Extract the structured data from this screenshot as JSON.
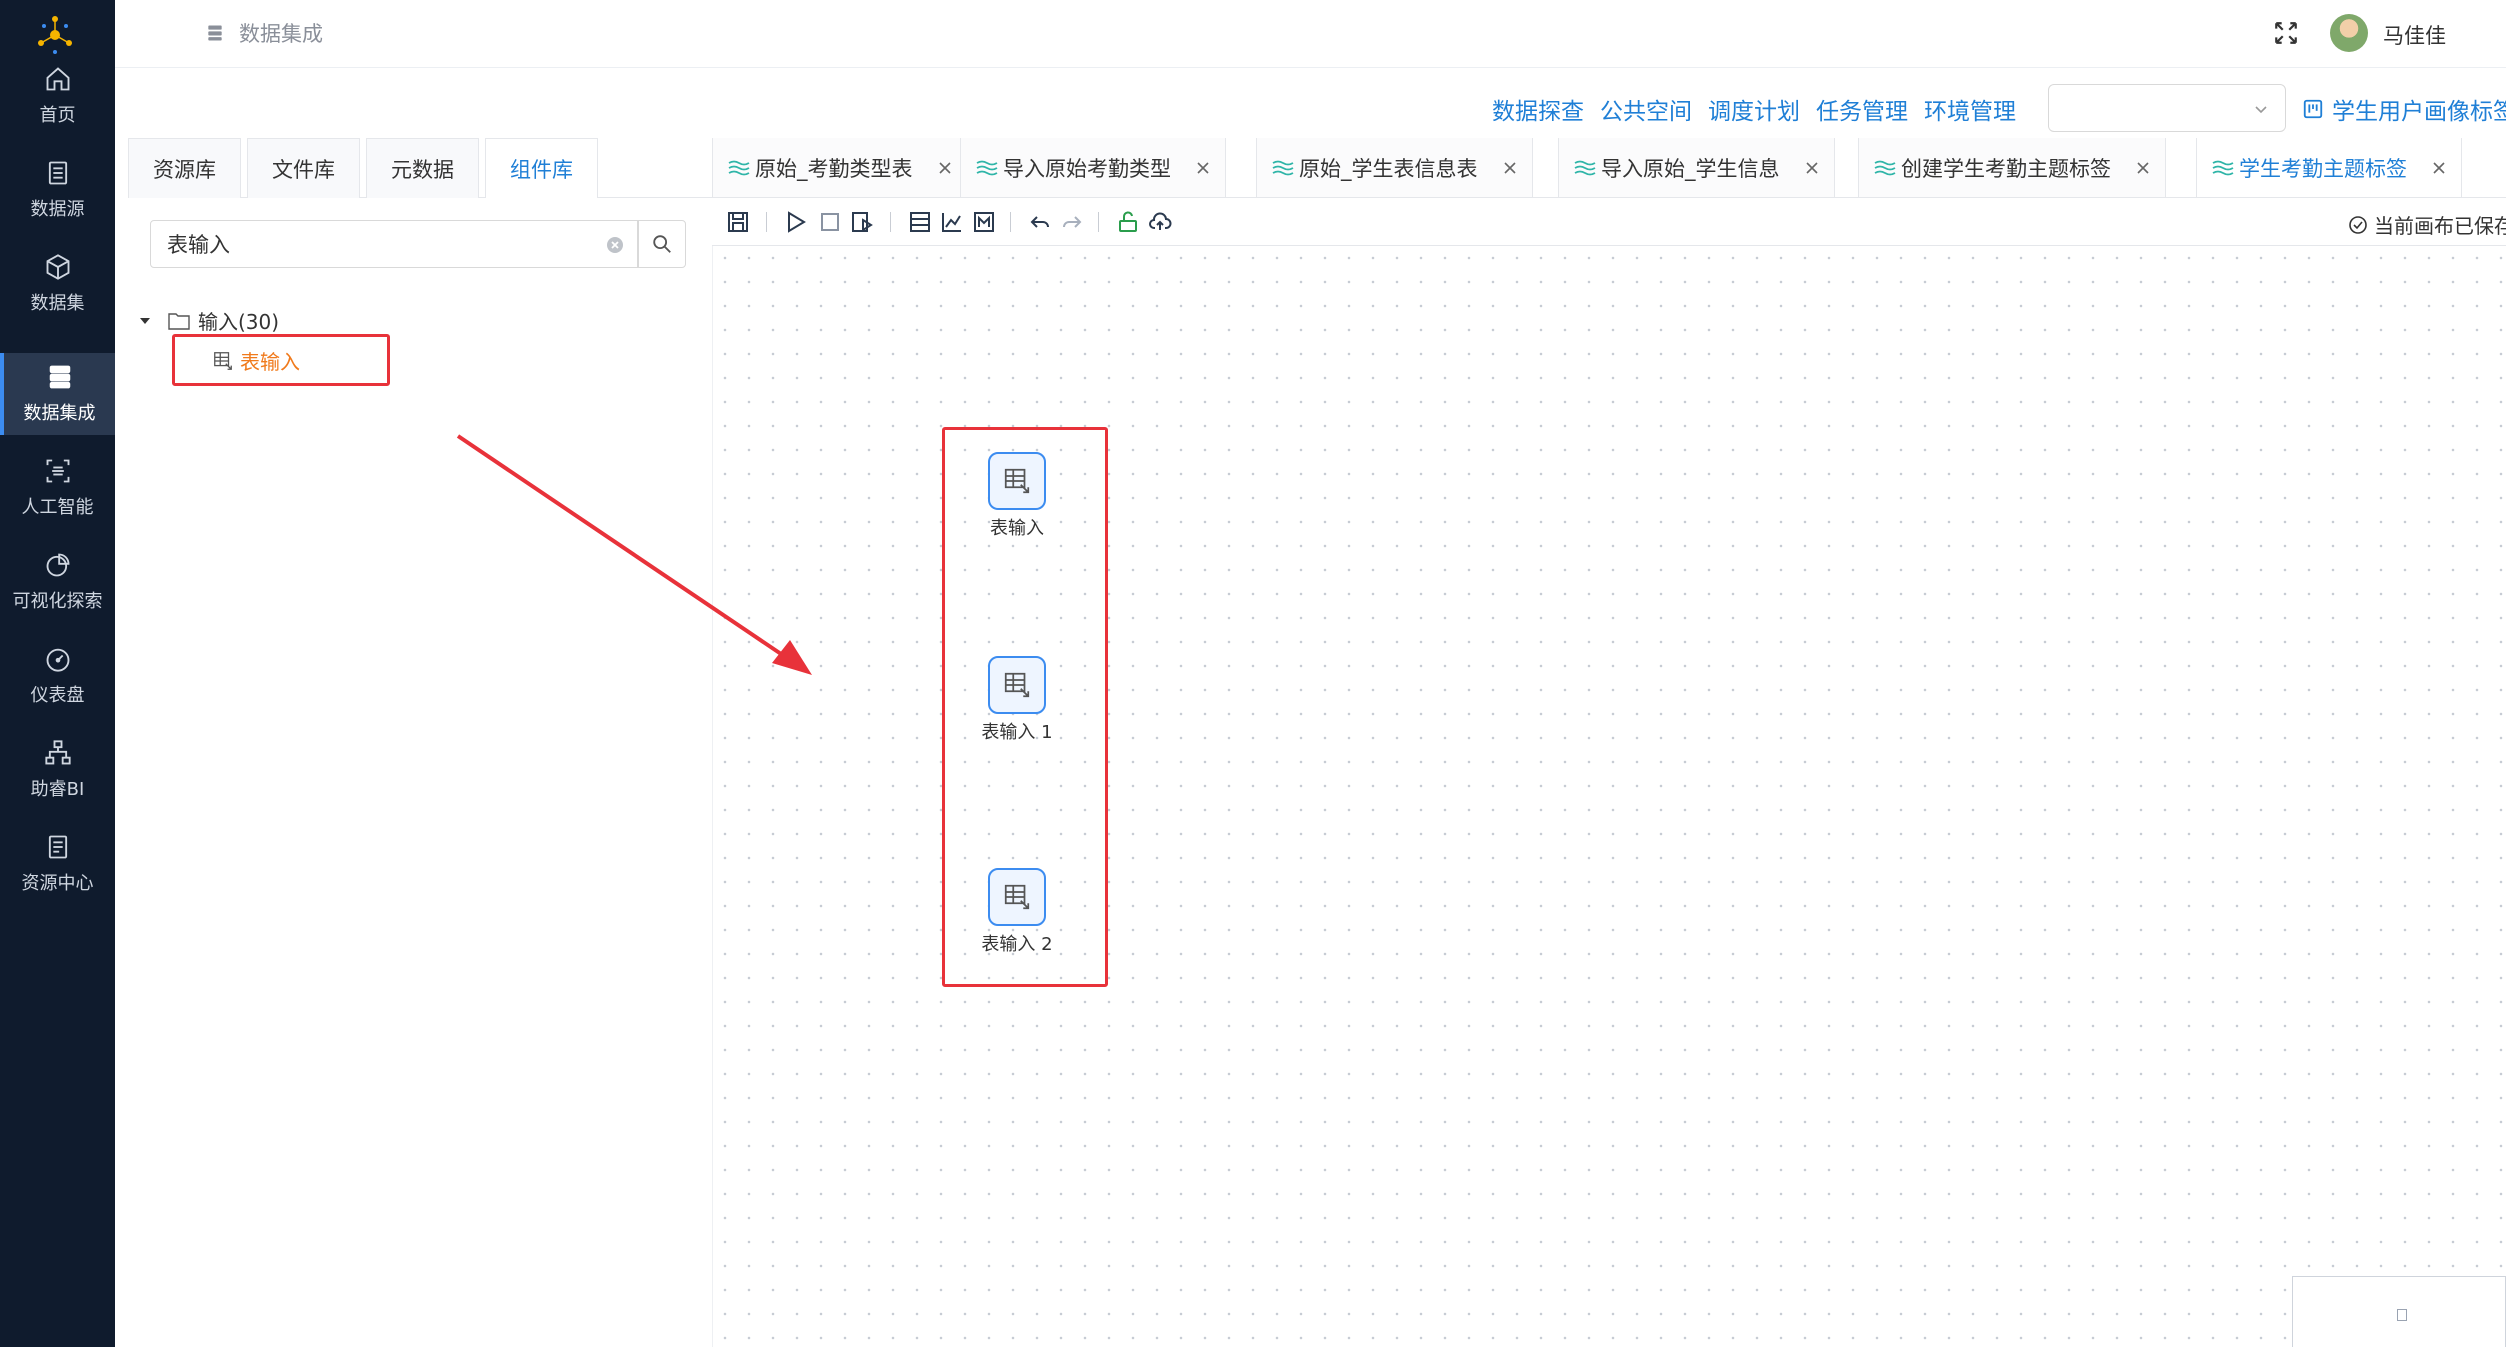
{
  "header": {
    "breadcrumb": "数据集成",
    "username": "马佳佳"
  },
  "sidebar": {
    "items": [
      {
        "label": "首页",
        "icon": "home-icon"
      },
      {
        "label": "数据源",
        "icon": "datasource-icon"
      },
      {
        "label": "数据集",
        "icon": "cube-icon"
      },
      {
        "label": "数据集成",
        "icon": "server-icon",
        "active": true
      },
      {
        "label": "人工智能",
        "icon": "ai-icon"
      },
      {
        "label": "可视化探索",
        "icon": "pie-chart-icon"
      },
      {
        "label": "仪表盘",
        "icon": "gauge-icon"
      },
      {
        "label": "助睿BI",
        "icon": "org-chart-icon"
      },
      {
        "label": "资源中心",
        "icon": "resource-icon"
      }
    ]
  },
  "top_menu": {
    "links": [
      "数据探查",
      "公共空间",
      "调度计划",
      "任务管理",
      "环境管理"
    ],
    "env_select_value": "",
    "project_title": "学生用户画像标签"
  },
  "left_panel": {
    "tabs": [
      "资源库",
      "文件库",
      "元数据",
      "组件库"
    ],
    "active_tab": "组件库",
    "search_value": "表输入",
    "tree": {
      "folder_label": "输入(30)",
      "leaf_label": "表输入"
    }
  },
  "canvas_tabs": [
    {
      "label": "原始_考勤类型表"
    },
    {
      "label": "导入原始考勤类型"
    },
    {
      "label": "原始_学生表信息表"
    },
    {
      "label": "导入原始_学生信息"
    },
    {
      "label": "创建学生考勤主题标签"
    },
    {
      "label": "学生考勤主题标签",
      "active": true
    }
  ],
  "toolbar": {
    "saved_status": "当前画布已保存"
  },
  "canvas": {
    "nodes": [
      {
        "label": "表输入"
      },
      {
        "label": "表输入 1"
      },
      {
        "label": "表输入 2"
      }
    ]
  },
  "colors": {
    "sidebar_bg": "#0f1b2d",
    "accent": "#1f7fd6",
    "highlight_red": "#e8323a",
    "active_leaf": "#f07a1c"
  }
}
